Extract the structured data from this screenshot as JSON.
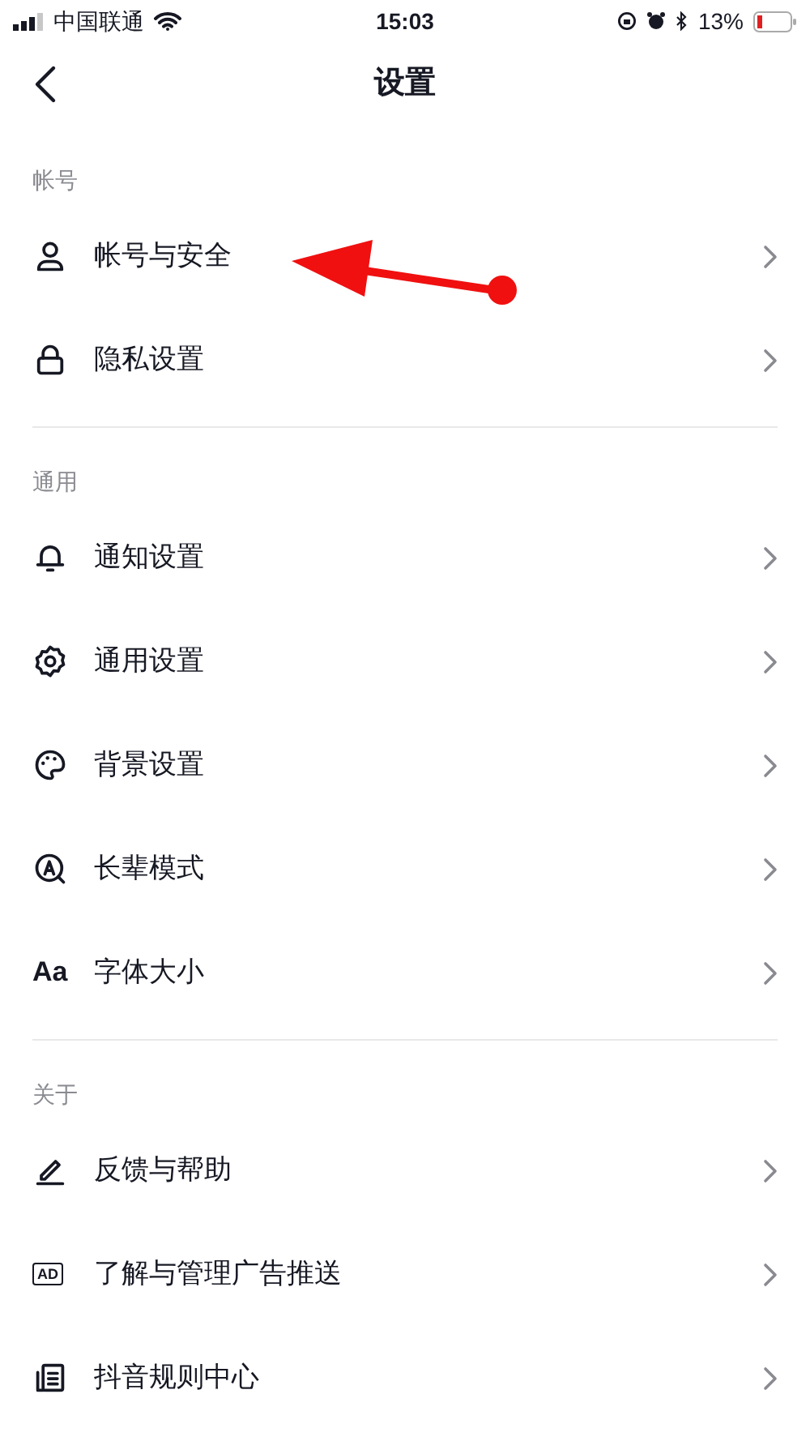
{
  "status_bar": {
    "carrier": "中国联通",
    "time": "15:03",
    "battery": "13%"
  },
  "nav": {
    "title": "设置"
  },
  "sections": [
    {
      "header": "帐号",
      "items": [
        {
          "kind": "user",
          "label": "帐号与安全"
        },
        {
          "kind": "lock",
          "label": "隐私设置"
        }
      ]
    },
    {
      "header": "通用",
      "items": [
        {
          "kind": "bell",
          "label": "通知设置"
        },
        {
          "kind": "gear",
          "label": "通用设置"
        },
        {
          "kind": "palette",
          "label": "背景设置"
        },
        {
          "kind": "elder",
          "label": "长辈模式"
        },
        {
          "kind": "text",
          "icon_text": "Aa",
          "label": "字体大小"
        }
      ]
    },
    {
      "header": "关于",
      "items": [
        {
          "kind": "pencil",
          "label": "反馈与帮助"
        },
        {
          "kind": "ad",
          "icon_text": "AD",
          "label": "了解与管理广告推送"
        },
        {
          "kind": "doc",
          "label": "抖音规则中心"
        }
      ]
    }
  ],
  "annotation": {
    "kind": "arrow"
  }
}
